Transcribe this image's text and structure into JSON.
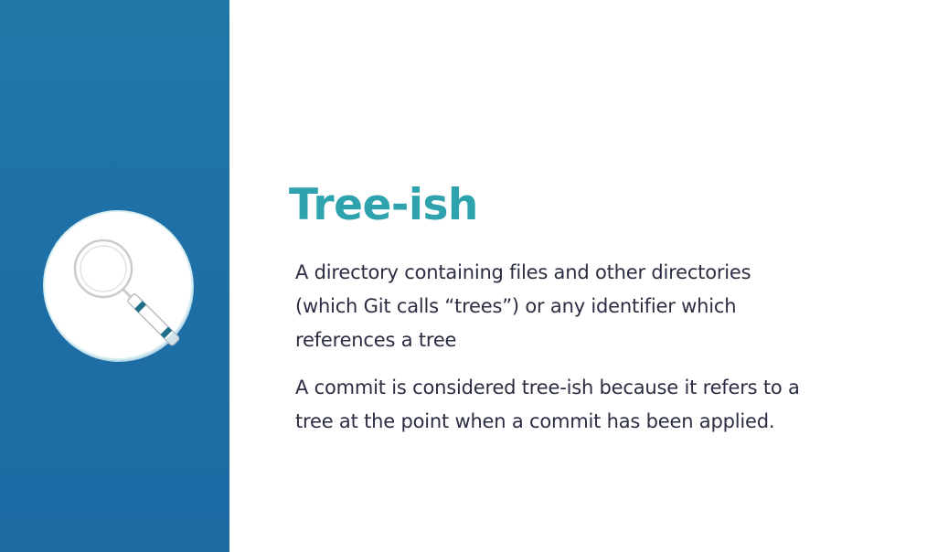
{
  "slide": {
    "title": "Tree-ish",
    "paragraphs": [
      "A directory containing files and other directories (which Git calls “trees”) or any identifier which references a tree",
      "A commit is considered tree-ish because it refers to a tree at the point when a commit has been applied."
    ],
    "icon": "magnifying-glass-icon"
  },
  "colors": {
    "panel": "#1e70a6",
    "title": "#2ea3ae",
    "body_text": "#2b2d42",
    "background": "#ffffff",
    "icon_accent": "#1f6f8b"
  }
}
